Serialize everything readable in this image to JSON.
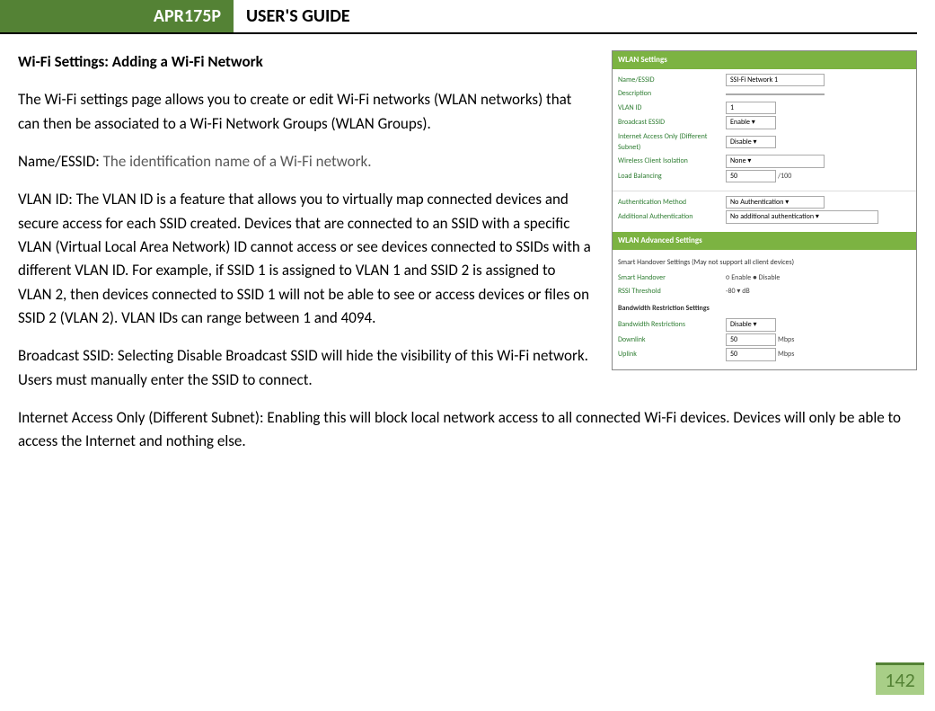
{
  "header": {
    "product": "APR175P",
    "title": "USER'S GUIDE"
  },
  "section_title": "Wi-Fi Settings: Adding a Wi-Fi Network",
  "intro": "The Wi-Fi settings page allows you to create or edit Wi-Fi networks (WLAN networks) that can then be associated to a Wi-Fi Network Groups (WLAN Groups).",
  "name_essid_label": "Name/ESSID: ",
  "name_essid_desc": "The identification name of a Wi-Fi network.",
  "vlan_text": "VLAN ID: The VLAN ID is a feature that allows you to virtually map connected devices and secure access for each SSID created. Devices that are connected to an SSID with a specific VLAN (Virtual Local Area Network) ID cannot access or see devices connected to SSIDs with a different VLAN ID. For example, if SSID 1 is assigned to VLAN 1 and SSID 2 is assigned to VLAN 2, then devices connected to SSID 1 will not be able to see or access devices or files on SSID 2 (VLAN 2). VLAN IDs can range between 1 and 4094.",
  "broadcast_text": "Broadcast SSID: Selecting Disable Broadcast SSID will hide the visibility of this Wi-Fi network. Users must manually enter the SSID to connect.",
  "internet_text": "Internet Access Only (Different Subnet): Enabling this will block local network access to all connected Wi-Fi devices.  Devices will only be able to access the Internet and nothing else.",
  "page_number": "142",
  "figure": {
    "hdr1": "WLAN Settings",
    "rows1": [
      {
        "label": "Name/ESSID",
        "value": "SSI-Fi Network 1",
        "wide": true
      },
      {
        "label": "Description",
        "value": "",
        "wide": true
      },
      {
        "label": "VLAN ID",
        "value": "1"
      },
      {
        "label": "Broadcast ESSID",
        "value": "Enable ▾"
      },
      {
        "label": "Internet Access Only (Different Subnet)",
        "value": "Disable ▾"
      },
      {
        "label": "Wireless Client Isolation",
        "value": "None ▾",
        "wide": true
      },
      {
        "label": "Load Balancing",
        "value": "50",
        "suffix": "/100"
      }
    ],
    "rows1b": [
      {
        "label": "Authentication Method",
        "value": "No Authentication ▾",
        "wide": true
      },
      {
        "label": "Additional Authentication",
        "value": "No additional authentication ▾",
        "wide": true,
        "xwide": true
      }
    ],
    "hdr2": "WLAN Advanced Settings",
    "note": "Smart Handover Settings (May not support all client devices)",
    "rows2": [
      {
        "label": "Smart Handover",
        "value": "○ Enable ● Disable",
        "plain": true
      },
      {
        "label": "RSSI Threshold",
        "value": "-80 ▾  dB",
        "plain": true
      }
    ],
    "note2": "Bandwidth Restriction Settings",
    "rows3": [
      {
        "label": "Bandwidth Restrictions",
        "value": "Disable ▾"
      },
      {
        "label": "Downlink",
        "value": "50",
        "suffix": "Mbps"
      },
      {
        "label": "Uplink",
        "value": "50",
        "suffix": "Mbps"
      }
    ]
  }
}
